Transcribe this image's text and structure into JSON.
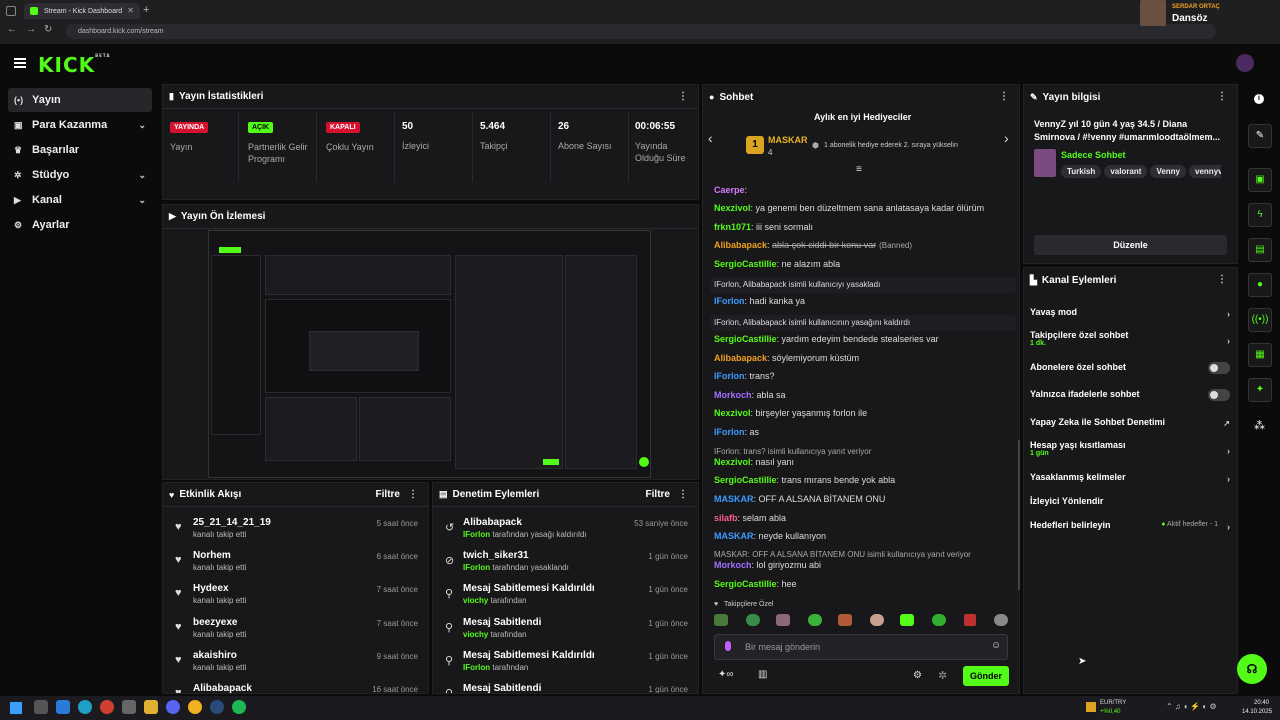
{
  "browser": {
    "tab_title": "Stream - Kick Dashboard",
    "url": "dashboard.kick.com/stream",
    "profile_name": "SERDAR ORTAÇ",
    "profile_sub": "Dansöz"
  },
  "app": {
    "logo": "KICK",
    "logo_tag": "BETA"
  },
  "sidebar": {
    "items": [
      {
        "label": "Yayın",
        "icon": "broadcast-icon"
      },
      {
        "label": "Para Kazanma",
        "icon": "wallet-icon"
      },
      {
        "label": "Başarılar",
        "icon": "trophy-icon"
      },
      {
        "label": "Stüdyo",
        "icon": "gear-icon"
      },
      {
        "label": "Kanal",
        "icon": "video-icon"
      },
      {
        "label": "Ayarlar",
        "icon": "settings-icon"
      }
    ]
  },
  "stats": {
    "title": "Yayın İstatistikleri",
    "cells": [
      {
        "value": "YAYINDA",
        "label": "Yayın",
        "kind": "red"
      },
      {
        "value": "AÇIK",
        "label": "Partnerlik Gelir Programı",
        "kind": "green"
      },
      {
        "value": "KAPALI",
        "label": "Çoklu Yayın",
        "kind": "red"
      },
      {
        "value": "50",
        "label": "İzleyici",
        "kind": "text"
      },
      {
        "value": "5.464",
        "label": "Takipçi",
        "kind": "text"
      },
      {
        "value": "26",
        "label": "Abone Sayısı",
        "kind": "text"
      },
      {
        "value": "00:06:55",
        "label": "Yayında Olduğu Süre",
        "kind": "text"
      }
    ]
  },
  "preview": {
    "title": "Yayın Ön İzlemesi"
  },
  "activity": {
    "title": "Etkinlik Akışı",
    "filter": "Filtre",
    "rows": [
      {
        "name": "25_21_14_21_19",
        "sub": "kanalı takip etti",
        "time": "5 saat önce"
      },
      {
        "name": "Norhem",
        "sub": "kanalı takip etti",
        "time": "6 saat önce"
      },
      {
        "name": "Hydeex",
        "sub": "kanalı takip etti",
        "time": "7 saat önce"
      },
      {
        "name": "beezyexe",
        "sub": "kanalı takip etti",
        "time": "7 saat önce"
      },
      {
        "name": "akaishiro",
        "sub": "kanalı takip etti",
        "time": "9 saat önce"
      },
      {
        "name": "Alibabapack",
        "sub": "",
        "time": "16 saat önce"
      }
    ]
  },
  "moderation": {
    "title": "Denetim Eylemleri",
    "filter": "Filtre",
    "rows": [
      {
        "name": "Alibabapack",
        "actor": "IForlon",
        "sub": "tarafından yasağı kaldırıldı",
        "time": "53 saniye önce",
        "icon": "undo-icon"
      },
      {
        "name": "twich_siker31",
        "actor": "IForlon",
        "sub": "tarafından yasaklandı",
        "time": "1 gün önce",
        "icon": "ban-icon"
      },
      {
        "name": "Mesaj Sabitlemesi Kaldırıldı",
        "actor": "viochy",
        "sub": "tarafından",
        "time": "1 gün önce",
        "icon": "unpin-icon"
      },
      {
        "name": "Mesaj Sabitlendi",
        "actor": "viochy",
        "sub": "tarafından",
        "time": "1 gün önce",
        "icon": "pin-icon"
      },
      {
        "name": "Mesaj Sabitlemesi Kaldırıldı",
        "actor": "IForlon",
        "sub": "tarafından",
        "time": "1 gün önce",
        "icon": "unpin-icon"
      },
      {
        "name": "Mesaj Sabitlendi",
        "actor": "",
        "sub": "",
        "time": "1 gün önce",
        "icon": "pin-icon"
      }
    ]
  },
  "chat": {
    "title": "Sohbet",
    "gifters_title": "Aylık en iyi Hediyeciler",
    "top_gifter": "MASKAR",
    "top_gifter_count": "4",
    "gifter_note": "1 abonelik hediye ederek 2. sıraya yükselin",
    "messages": [
      {
        "user": "Caerpe",
        "color": "#d57bff",
        "text": ""
      },
      {
        "user": "Nexzivol",
        "color": "#53fc18",
        "text": "ya genemi ben düzeltmem sana anlatasaya kadar ölürüm"
      },
      {
        "user": "frkn1071",
        "color": "#53fc18",
        "text": "iii seni sormalı"
      },
      {
        "user": "Alibabapack",
        "color": "#f0a020",
        "text": "abla çok ciddi bir konu var",
        "banned": "(Banned)"
      },
      {
        "user": "SergioCastillie",
        "color": "#53fc18",
        "text": "ne alazım abla"
      },
      {
        "system": "IForlon, Alibabapack isimli kullanıcıyı yasakladı"
      },
      {
        "user": "IForlon",
        "color": "#3b9bff",
        "text": "hadi kanka ya"
      },
      {
        "system": "IForlon, Alibabapack isimli kullanıcının yasağını kaldırdı"
      },
      {
        "user": "SergioCastillie",
        "color": "#53fc18",
        "text": "yardım edeyim bendede stealseries var"
      },
      {
        "user": "Alibabapack",
        "color": "#f0a020",
        "text": "söylemiyorum küstüm"
      },
      {
        "user": "IForlon",
        "color": "#3b9bff",
        "text": "trans?"
      },
      {
        "user": "Morkoch",
        "color": "#a070ff",
        "text": "abla sa"
      },
      {
        "user": "Nexzivol",
        "color": "#53fc18",
        "text": "birşeyler yaşanmış forlon ile"
      },
      {
        "user": "IForlon",
        "color": "#3b9bff",
        "text": "as"
      },
      {
        "reply": "IForlon: trans? isimli kullanıcıya yanıt veriyor"
      },
      {
        "user": "Nexzivol",
        "color": "#53fc18",
        "text": "nasıl yanı"
      },
      {
        "user": "SergioCastillie",
        "color": "#53fc18",
        "text": "trans mırans bende yok abla"
      },
      {
        "user": "MASKAR",
        "color": "#3b9bff",
        "text": "OFF A ALSANA BİTANEM ONU"
      },
      {
        "user": "silafb",
        "color": "#ff5c8a",
        "text": "selam abla"
      },
      {
        "user": "MASKAR",
        "color": "#3b9bff",
        "text": "neyde kullanıyon"
      },
      {
        "reply": "MASKAR: OFF A ALSANA BİTANEM ONU isimli kullanıcıya yanıt veriyor"
      },
      {
        "user": "Morkoch",
        "color": "#a070ff",
        "text": "lol giriyozmu abi"
      },
      {
        "user": "SergioCastillie",
        "color": "#53fc18",
        "text": "hee"
      }
    ],
    "followers_only": "Takipçilere Özel",
    "input_placeholder": "Bir mesaj gönderin",
    "send_label": "Gönder"
  },
  "stream_info": {
    "title": "Yayın bilgisi",
    "stream_title": "VennyZ yıl 10 gün 4 yaş 34.5 / Diana Smirnova / #!venny #umarımloodtaölmem...",
    "category": "Sadece Sohbet",
    "tags": [
      "Turkish",
      "valorant",
      "Venny",
      "vennyv"
    ],
    "edit_label": "Düzenle"
  },
  "channel_actions": {
    "title": "Kanal Eylemleri",
    "rows": [
      {
        "label": "Yavaş mod",
        "sub": "",
        "control": "chevron"
      },
      {
        "label": "Takipçilere özel sohbet",
        "sub": "1 dk.",
        "control": "chevron"
      },
      {
        "label": "Abonelere özel sohbet",
        "sub": "",
        "control": "toggle"
      },
      {
        "label": "Yalnızca ifadelerle sohbet",
        "sub": "",
        "control": "toggle"
      },
      {
        "label": "Yapay Zeka ile Sohbet Denetimi",
        "sub": "",
        "control": "external"
      },
      {
        "label": "Hesap yaşı kısıtlaması",
        "sub": "1 gün",
        "control": "chevron"
      },
      {
        "label": "Yasaklanmış kelimeler",
        "sub": "",
        "control": "chevron"
      },
      {
        "label": "İzleyici Yönlendir",
        "sub": "",
        "control": "none"
      },
      {
        "label": "Hedefleri belirleyin",
        "sub": "",
        "control": "chevron",
        "status": "Aktif hedefler - 1"
      }
    ]
  },
  "taskbar": {
    "ticker": "EUR/TRY",
    "ticker_change": "+%0,40",
    "time": "20:40",
    "date": "14.10.2025"
  },
  "colors": {
    "accent": "#53fc18",
    "live": "#d6112e",
    "panel": "#18181b",
    "bg": "#0b0b0c"
  }
}
